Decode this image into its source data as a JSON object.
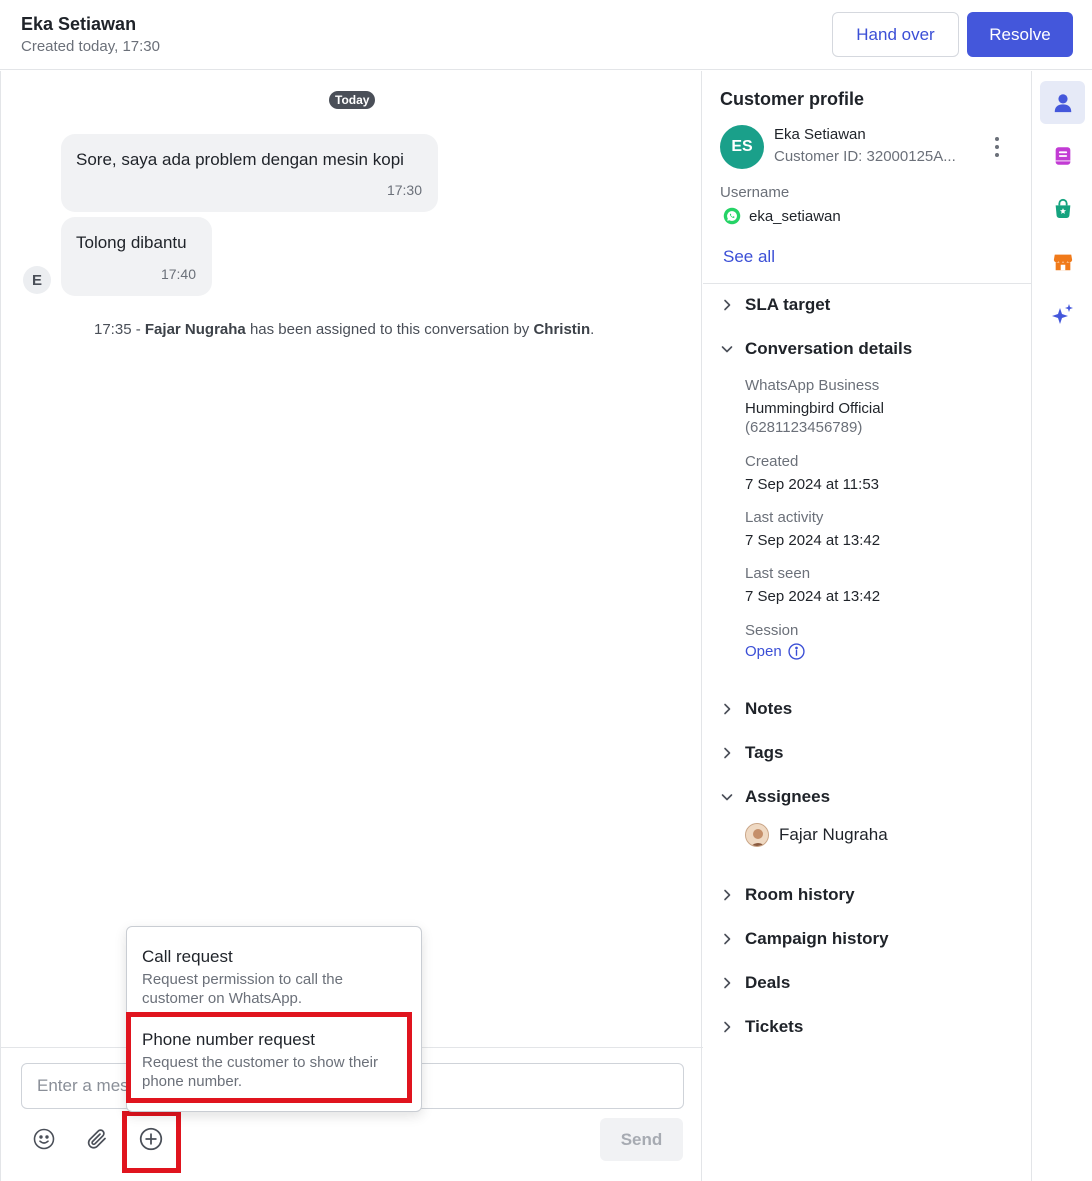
{
  "header": {
    "customer_name": "Eka Setiawan",
    "created": "Created today, 17:30",
    "handover_label": "Hand over",
    "resolve_label": "Resolve"
  },
  "chat": {
    "date_label": "Today",
    "messages": [
      {
        "text": "Sore, saya ada problem dengan mesin kopi",
        "time": "17:30"
      },
      {
        "text": "Tolong dibantu",
        "time": "17:40"
      }
    ],
    "sender_initial": "E",
    "system": {
      "time": "17:35",
      "dash": "-",
      "agent": "Fajar Nugraha",
      "middle": "has been assigned to this conversation by",
      "by": "Christin",
      "end": "."
    }
  },
  "composer": {
    "placeholder": "Enter a message",
    "send_label": "Send"
  },
  "popup": {
    "items": [
      {
        "title": "Call request",
        "description": "Request permission to call the customer on WhatsApp."
      },
      {
        "title": "Phone number request",
        "description": "Request the customer to show their phone number."
      }
    ]
  },
  "profile": {
    "title": "Customer profile",
    "initials": "ES",
    "name": "Eka Setiawan",
    "customer_id": "Customer ID: 32000125A...",
    "username_label": "Username",
    "username": "eka_setiawan",
    "see_all": "See all"
  },
  "sections": {
    "sla": "SLA target",
    "conversation": "Conversation details",
    "notes": "Notes",
    "tags": "Tags",
    "assignees": "Assignees",
    "room_history": "Room history",
    "campaign_history": "Campaign history",
    "deals": "Deals",
    "tickets": "Tickets"
  },
  "details": {
    "channel_label": "WhatsApp Business",
    "channel_name": "Hummingbird Official",
    "channel_number": "(6281123456789)",
    "created_label": "Created",
    "created_value": "7 Sep 2024 at 11:53",
    "last_activity_label": "Last activity",
    "last_activity_value": "7 Sep 2024 at 13:42",
    "last_seen_label": "Last seen",
    "last_seen_value": "7 Sep 2024 at 13:42",
    "session_label": "Session",
    "session_value": "Open"
  },
  "assignee": {
    "name": "Fajar Nugraha"
  },
  "colors": {
    "primary": "#4457db",
    "link": "#3b4fd6",
    "avatar_green": "#1aa08a",
    "highlight_red": "#e0141e"
  }
}
